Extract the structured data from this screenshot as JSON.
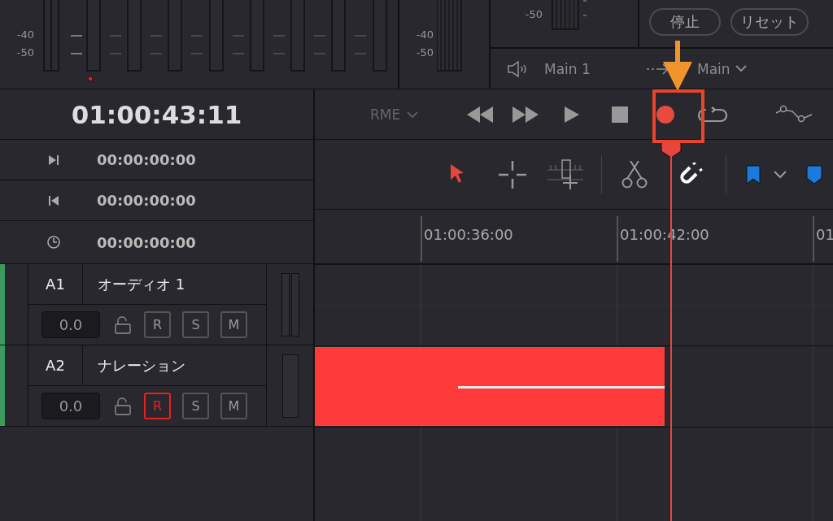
{
  "main_meters": {
    "scale_labels": [
      "-40",
      "-50"
    ]
  },
  "bus_meter": {
    "scale_labels": [
      "-40",
      "-50"
    ]
  },
  "control_room": {
    "meter_scale_labels": [
      "-50"
    ],
    "buttons": [
      "停止",
      "リセット"
    ],
    "output": "Main 1",
    "route": "Main"
  },
  "transport": {
    "timecode": "01:00:43:11",
    "device": "RME",
    "buttons": [
      {
        "kind": "rewind"
      },
      {
        "kind": "forward"
      },
      {
        "kind": "play"
      },
      {
        "kind": "stop"
      },
      {
        "kind": "record"
      },
      {
        "kind": "loop"
      },
      {
        "kind": "automation"
      }
    ]
  },
  "timecodes": [
    {
      "kind": "in",
      "value": "00:00:00:00"
    },
    {
      "kind": "out",
      "value": "00:00:00:00"
    },
    {
      "kind": "duration",
      "value": "00:00:00:00"
    }
  ],
  "tools": [
    {
      "kind": "pointer",
      "selected": true
    },
    {
      "kind": "range",
      "selected": false
    },
    {
      "kind": "slip",
      "selected": false
    },
    {
      "kind": "divider"
    },
    {
      "kind": "razor",
      "selected": false
    },
    {
      "kind": "snap",
      "on": true
    },
    {
      "kind": "divider"
    },
    {
      "kind": "flag"
    },
    {
      "kind": "dropdown"
    },
    {
      "kind": "marker"
    }
  ],
  "ruler": {
    "labels": [
      "01:00:36:00",
      "01:00:42:00",
      "01"
    ]
  },
  "tracks": [
    {
      "id": "A1",
      "name": "オーディオ 1",
      "volume": "0.0",
      "record_label": "R",
      "record_armed": false,
      "solo_label": "S",
      "mute_label": "M",
      "kind": "stereo",
      "recording": false
    },
    {
      "id": "A2",
      "name": "ナレーション",
      "volume": "0.0",
      "record_label": "R",
      "record_armed": true,
      "solo_label": "S",
      "mute_label": "M",
      "kind": "mono",
      "recording": true
    }
  ]
}
